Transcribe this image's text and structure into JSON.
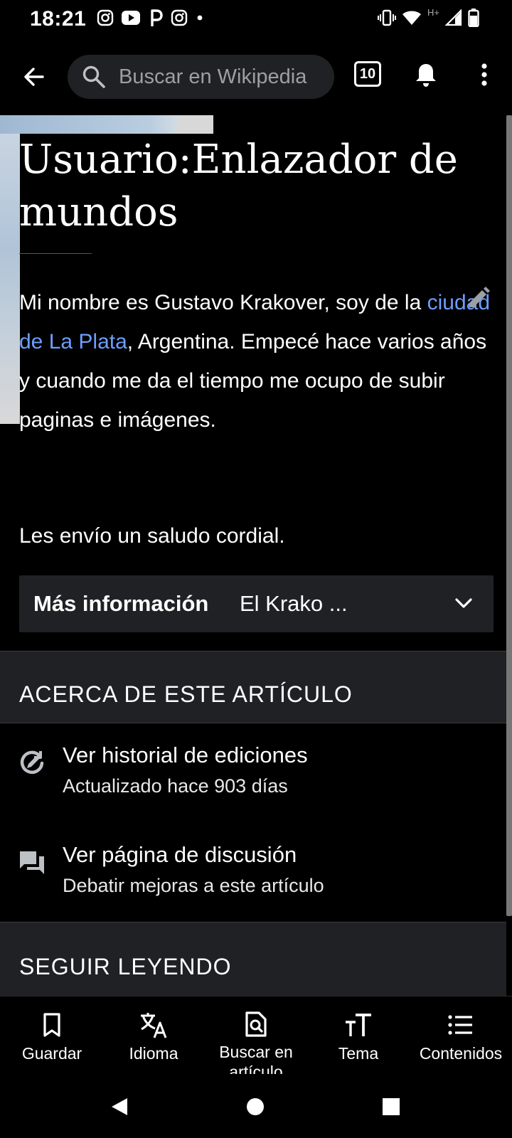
{
  "status_bar": {
    "time": "18:21",
    "network_label": "H+",
    "notification_icons": [
      "instagram-icon",
      "youtube-icon",
      "pinterest-icon",
      "instagram-icon",
      "dot-icon"
    ],
    "system_icons": [
      "vibrate-icon",
      "wifi-icon",
      "signal-icon",
      "battery-icon"
    ]
  },
  "toolbar": {
    "search_placeholder": "Buscar en Wikipedia",
    "tabs_count": "10"
  },
  "article": {
    "title": "Usuario:Enlazador de mundos",
    "para1_before_link": "Mi nombre es Gustavo Krakover, soy de la ",
    "para1_link": "ciudad de La Plata",
    "para1_after_link": ", Argentina. Empecé hace varios años y cuando me da el tiempo me ocupo de subir paginas e imágenes.",
    "para2": "Les envío un saludo cordial.",
    "more_info_label": "Más información",
    "more_info_value": "El Krako ..."
  },
  "about": {
    "heading": "ACERCA DE ESTE ARTÍCULO",
    "history_title": "Ver historial de ediciones",
    "history_sub": "Actualizado hace 903 días",
    "talk_title": "Ver página de discusión",
    "talk_sub": "Debatir mejoras a este artículo"
  },
  "continue": {
    "heading": "SEGUIR LEYENDO"
  },
  "actions": [
    {
      "label": "Guardar",
      "icon": "bookmark-icon"
    },
    {
      "label": "Idioma",
      "icon": "translate-icon"
    },
    {
      "label": "Buscar en artículo",
      "icon": "find-in-page-icon"
    },
    {
      "label": "Tema",
      "icon": "text-size-icon"
    },
    {
      "label": "Contenidos",
      "icon": "list-icon"
    }
  ],
  "colors": {
    "background": "#000000",
    "surface": "#202124",
    "link": "#6d9eff",
    "text": "#ffffff"
  }
}
